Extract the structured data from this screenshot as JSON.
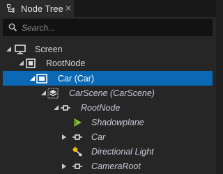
{
  "tab": {
    "title": "Node Tree",
    "close": "✕"
  },
  "search": {
    "placeholder": "Search..."
  },
  "tree": {
    "screen": "Screen",
    "root_node": "RootNode",
    "car": "Car (Car)",
    "car_scene": "CarScene (CarScene)",
    "scene_root_node": "RootNode",
    "shadowplane": "Shadowplane",
    "car_child": "Car",
    "directional_light": "Directional Light",
    "camera_root": "CameraRoot"
  },
  "colors": {
    "selection": "#0a68b5",
    "panel": "#262626",
    "tab": "#2a2a2a",
    "search": "#121212"
  }
}
